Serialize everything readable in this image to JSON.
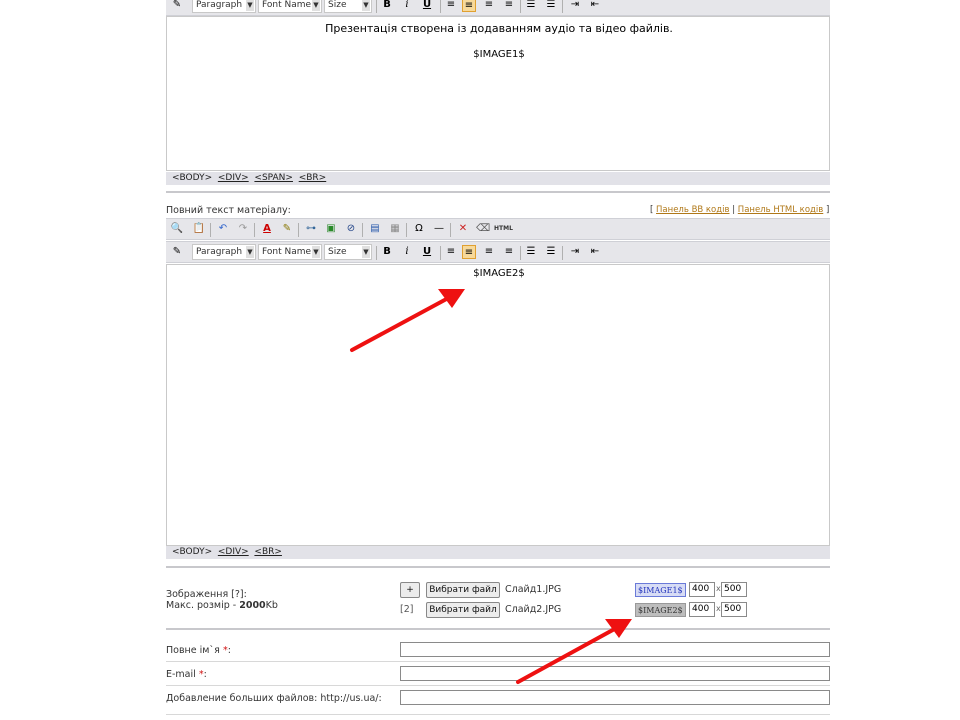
{
  "toolbar": {
    "format_select": "Paragraph",
    "font_select": "Font Name",
    "size_select": "Size",
    "bold": "B",
    "italic": "i",
    "underline": "U"
  },
  "top_editor": {
    "line1": "Презентація створена із додаванням аудіо та відео файлів.",
    "line2": "$IMAGE1$",
    "path": [
      "<BODY>",
      "<DIV>",
      "<SPAN>",
      "<BR>"
    ]
  },
  "full_text": {
    "label": "Повний текст матеріалу:",
    "panel_bb": "Панель BB кодів",
    "panel_html": "Панель HTML кодів",
    "html_icon": "HTML",
    "content": "$IMAGE2$",
    "path": [
      "<BODY>",
      "<DIV>",
      "<BR>"
    ]
  },
  "images": {
    "label": "Зображення [?]:",
    "max_size_prefix": "Макс. розмір - ",
    "max_size_value": "2000",
    "max_size_unit": "Kb",
    "add_button": "+",
    "row2_index": "[2]",
    "rows": [
      {
        "choose_label": "Вибрати файл",
        "file_name": "Слайд1.JPG",
        "tag": "$IMAGE1$",
        "width": "400",
        "height": "500"
      },
      {
        "choose_label": "Вибрати файл",
        "file_name": "Слайд2.JPG",
        "tag": "$IMAGE2$",
        "width": "400",
        "height": "500"
      }
    ],
    "x_sep": "x"
  },
  "form": {
    "full_name_label": "Повне ім`я",
    "email_label": "E-mail",
    "required_mark": "*",
    "colon": ":",
    "big_files_label": "Добавление больших файлов: http://us.ua/:"
  },
  "colors": {
    "arrow": "#ee1111",
    "toolbar_bg": "#e6e6ea",
    "link": "#b07818",
    "tag_active_bg": "#d7dcf5",
    "tag_inactive_bg": "#bdbdbd"
  }
}
